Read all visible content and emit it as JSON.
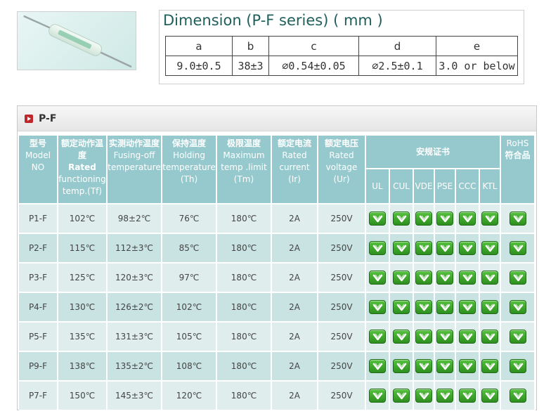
{
  "dimension": {
    "title": "Dimension (P-F series) ( mm )",
    "headers": [
      "a",
      "b",
      "c",
      "d",
      "e"
    ],
    "values": [
      "9.0±0.5",
      "38±3",
      "∅0.54±0.05",
      "∅2.5±0.1",
      "3.0 or below"
    ]
  },
  "panel": {
    "title": "P-F"
  },
  "columns": {
    "model": {
      "zh": "型号",
      "en1": "Model",
      "en2": "NO"
    },
    "rated": {
      "zh": "额定动作温度",
      "en_bold": "Rated",
      "en1": "functioning",
      "en2": "temp.(Tf)"
    },
    "fusing": {
      "zh": "实测动作温度",
      "en1": "Fusing-off",
      "en2": "temperature"
    },
    "holding": {
      "zh": "保持温度",
      "en1": "Holding",
      "en2": "temperature",
      "en3": "(Th)"
    },
    "limit": {
      "zh": "极限温度",
      "en1": "Maximum",
      "en2": "temp .limit",
      "en3": "(Tm)"
    },
    "current": {
      "zh": "额定电流",
      "en1": "Rated",
      "en2": "current",
      "en3": "(Ir)"
    },
    "voltage": {
      "zh": "额定电压",
      "en1": "Rated",
      "en2": "voltage",
      "en3": "(Ur)"
    },
    "certs": {
      "zh": "安规证书",
      "items": [
        "UL",
        "CUL",
        "VDE",
        "PSE",
        "CCC",
        "KTL"
      ]
    },
    "rohs": {
      "en": "RoHS",
      "zh": "符合品"
    }
  },
  "rows": [
    {
      "model": "P1-F",
      "tf": "102℃",
      "fusing": "98±2℃",
      "th": "76℃",
      "tm": "180℃",
      "ir": "2A",
      "ur": "250V"
    },
    {
      "model": "P2-F",
      "tf": "115℃",
      "fusing": "112±3℃",
      "th": "85℃",
      "tm": "180℃",
      "ir": "2A",
      "ur": "250V"
    },
    {
      "model": "P3-F",
      "tf": "125℃",
      "fusing": "120±3℃",
      "th": "97℃",
      "tm": "180℃",
      "ir": "2A",
      "ur": "250V"
    },
    {
      "model": "P4-F",
      "tf": "130℃",
      "fusing": "126±2℃",
      "th": "102℃",
      "tm": "180℃",
      "ir": "2A",
      "ur": "250V"
    },
    {
      "model": "P5-F",
      "tf": "135℃",
      "fusing": "131±3℃",
      "th": "105℃",
      "tm": "180℃",
      "ir": "2A",
      "ur": "250V"
    },
    {
      "model": "P9-F",
      "tf": "138℃",
      "fusing": "135±2℃",
      "th": "108℃",
      "tm": "180℃",
      "ir": "2A",
      "ur": "250V"
    },
    {
      "model": "P7-F",
      "tf": "150℃",
      "fusing": "145±3℃",
      "th": "120℃",
      "tm": "180℃",
      "ir": "2A",
      "ur": "250V"
    }
  ],
  "icons": {
    "cert": "check-icon",
    "header_bullet": "arrow-right-icon"
  },
  "colors": {
    "header_bg": "#96c9cd",
    "row_light": "#dfeeed",
    "row_dark": "#c8e3e2",
    "cert_green": "#3aa52a",
    "title_teal": "#1f5f5c",
    "bullet_red": "#c0272d"
  }
}
